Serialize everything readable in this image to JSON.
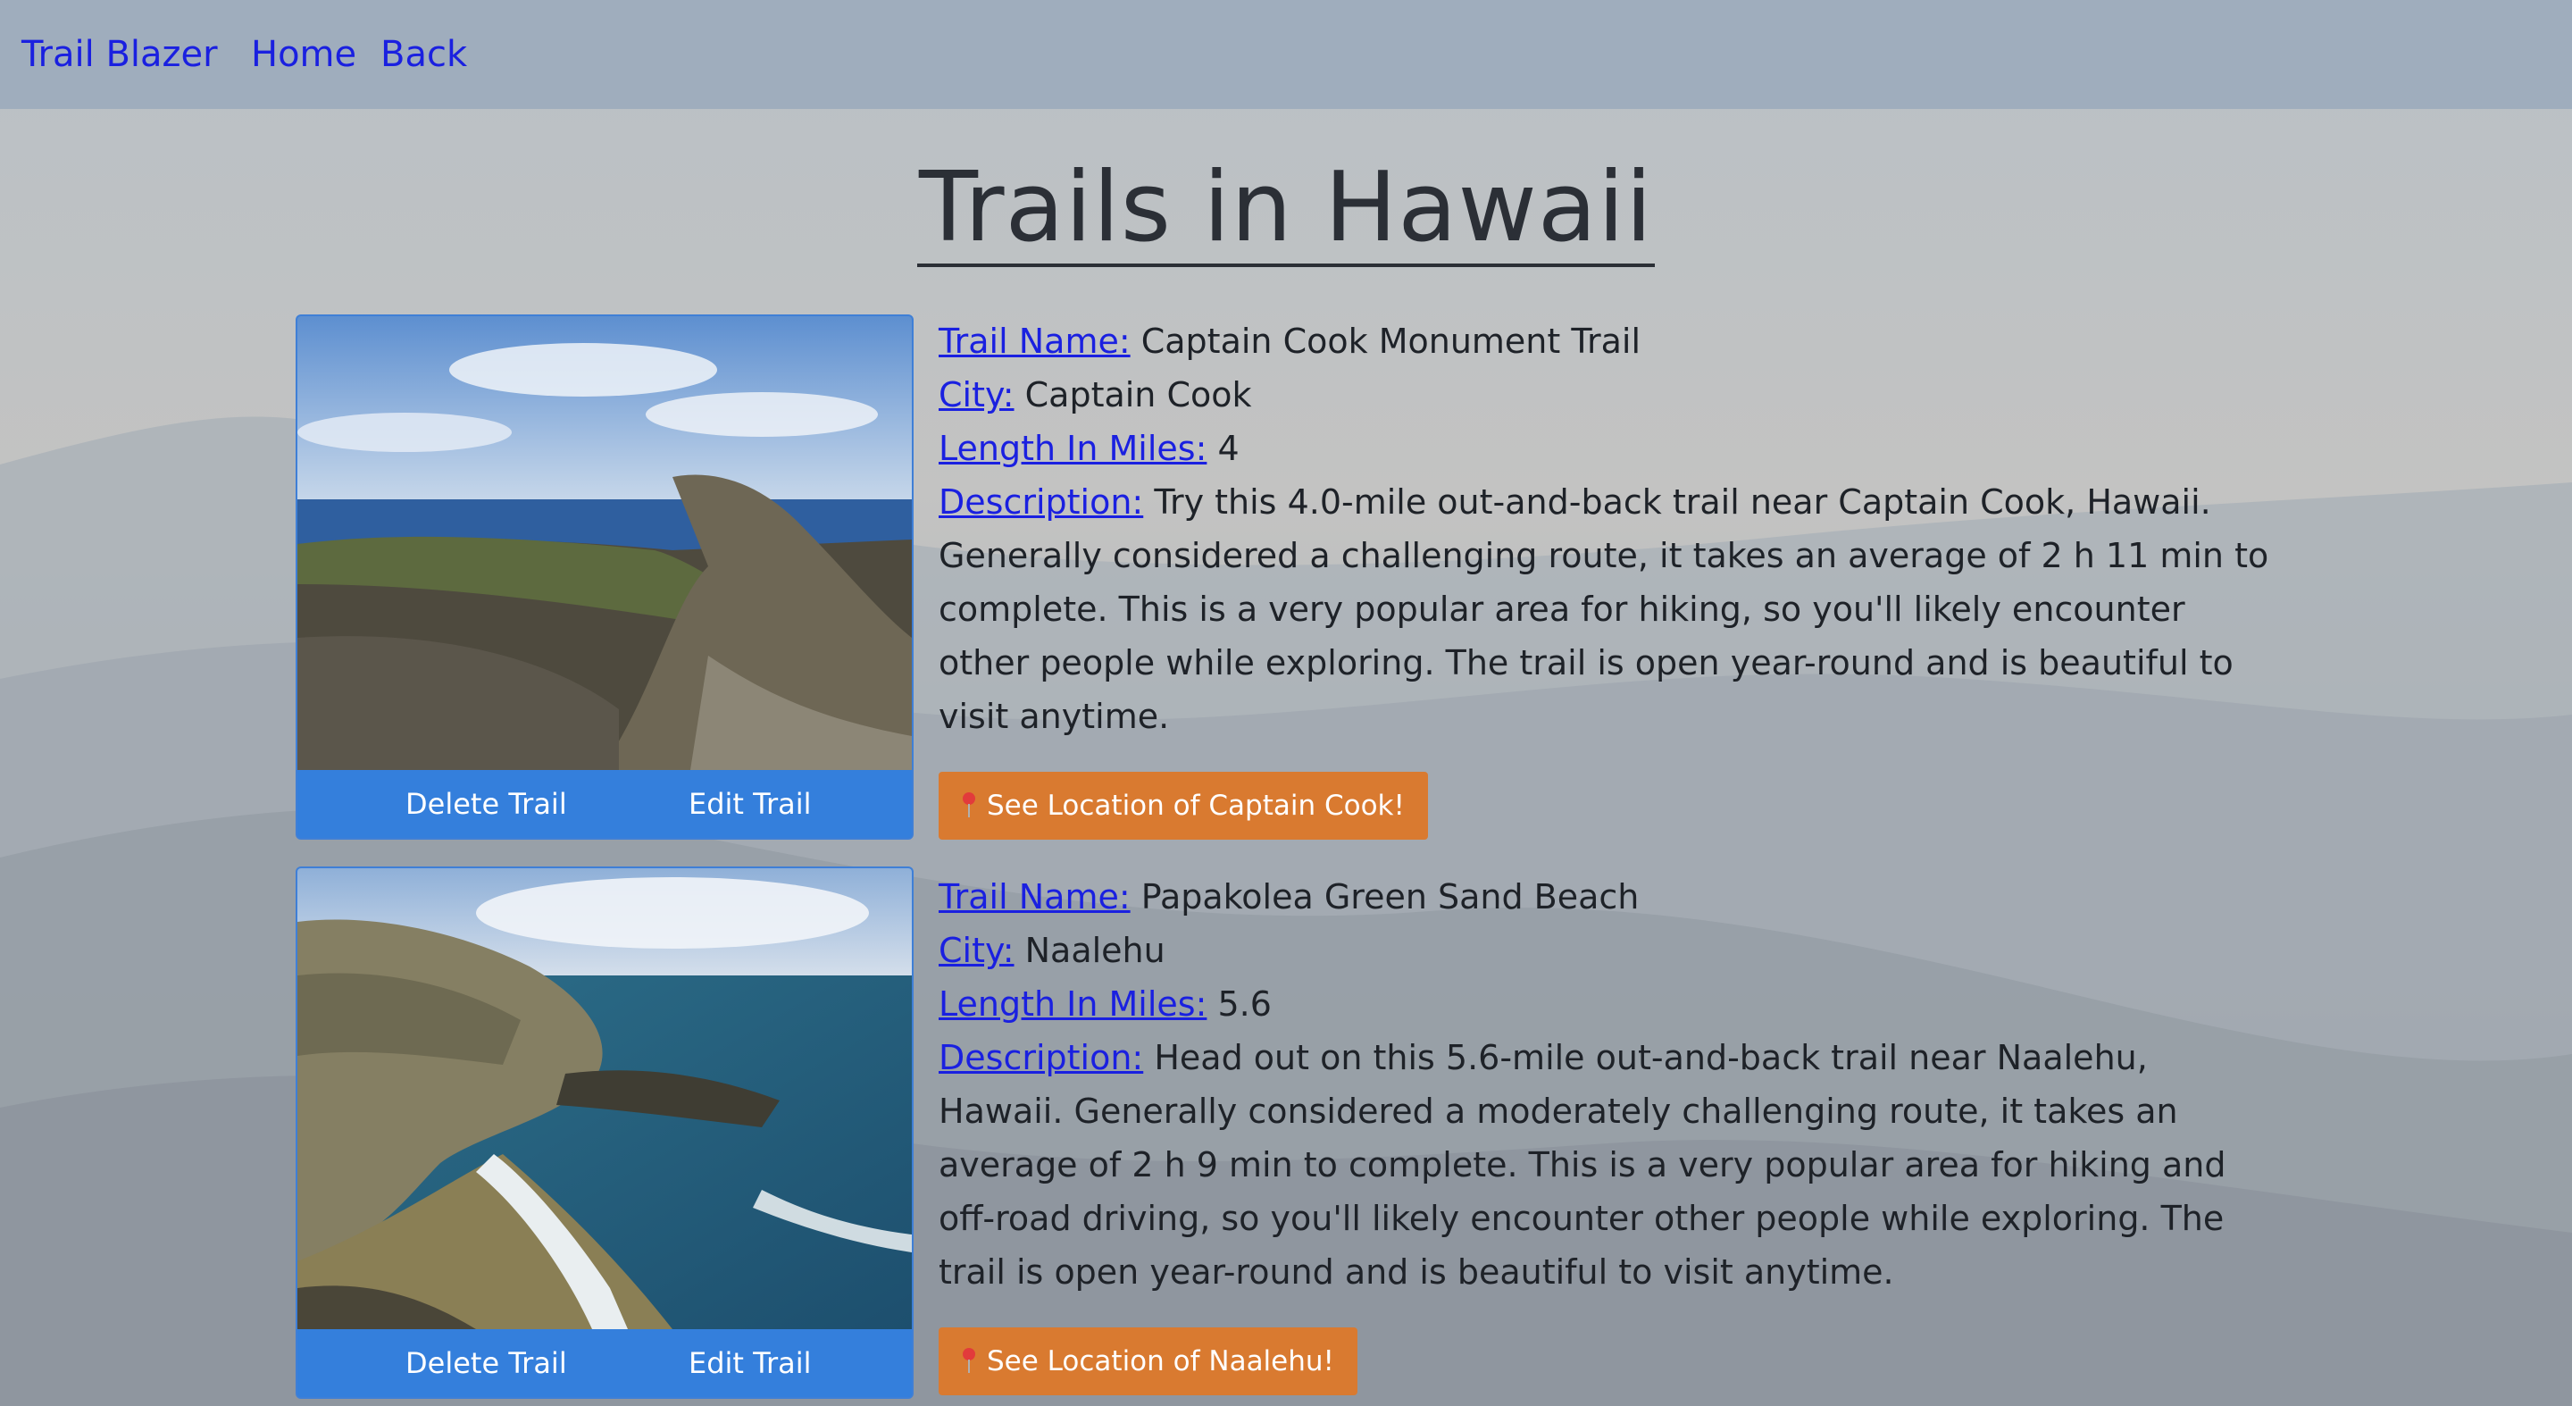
{
  "nav": {
    "brand": "Trail Blazer",
    "home": "Home",
    "back": "Back"
  },
  "page": {
    "title": "Trails in Hawaii"
  },
  "labels": {
    "trail_name": "Trail Name:",
    "city": "City:",
    "length": "Length In Miles:",
    "description": "Description:"
  },
  "trails": [
    {
      "name": "Captain Cook Monument Trail",
      "city": "Captain Cook",
      "length": "4",
      "description": "Try this 4.0-mile out-and-back trail near Captain Cook, Hawaii. Generally considered a challenging route, it takes an average of 2 h 11 min to complete. This is a very popular area for hiking, so you'll likely encounter other people while exploring. The trail is open year-round and is beautiful to visit anytime.",
      "delete_label": "Delete Trail",
      "edit_label": "Edit Trail",
      "location_label": "See Location of Captain Cook!"
    },
    {
      "name": "Papakolea Green Sand Beach",
      "city": "Naalehu",
      "length": "5.6",
      "description": "Head out on this 5.6-mile out-and-back trail near Naalehu, Hawaii. Generally considered a moderately challenging route, it takes an average of 2 h 9 min to complete. This is a very popular area for hiking and off-road driving, so you'll likely encounter other people while exploring. The trail is open year-round and is beautiful to visit anytime.",
      "delete_label": "Delete Trail",
      "edit_label": "Edit Trail",
      "location_label": "See Location of Naalehu!"
    }
  ],
  "colors": {
    "nav_bg": "#9fadbd",
    "link": "#1a20e0",
    "card_blue": "#347fdc",
    "location_orange": "#d97a30"
  }
}
